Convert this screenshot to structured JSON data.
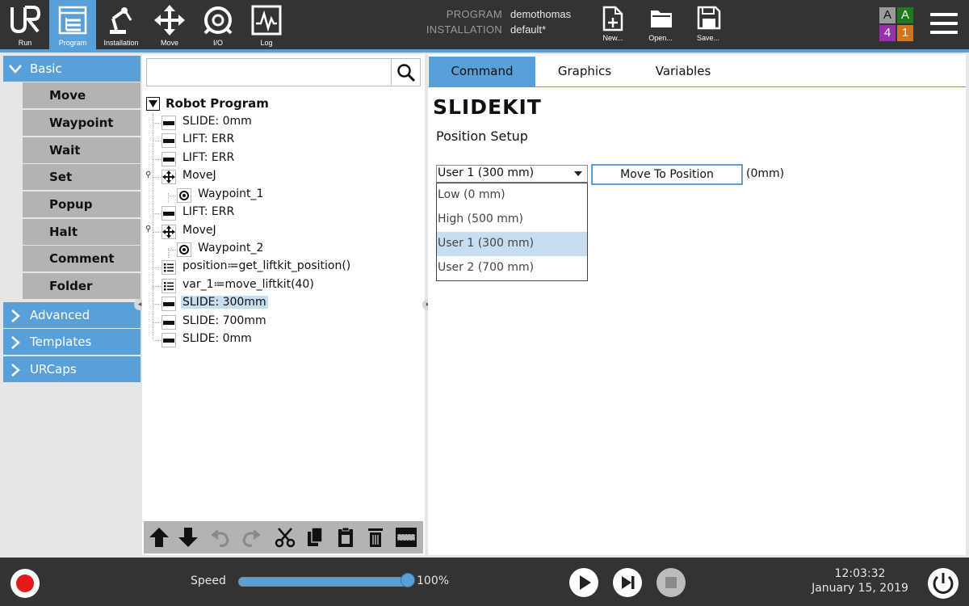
{
  "topbar": {
    "nav": [
      {
        "label": "Run",
        "icon": "ur-logo-icon",
        "active": false
      },
      {
        "label": "Program",
        "icon": "program-icon",
        "active": true
      },
      {
        "label": "Installation",
        "icon": "robot-arm-icon",
        "active": false
      },
      {
        "label": "Move",
        "icon": "move-arrows-icon",
        "active": false
      },
      {
        "label": "I/O",
        "icon": "io-icon",
        "active": false
      },
      {
        "label": "Log",
        "icon": "log-chart-icon",
        "active": false
      }
    ],
    "program_key": "PROGRAM",
    "program_value": "demothomas",
    "installation_key": "INSTALLATION",
    "installation_value": "default*",
    "file_buttons": [
      {
        "label": "New...",
        "icon": "new-file-icon"
      },
      {
        "label": "Open...",
        "icon": "open-folder-icon"
      },
      {
        "label": "Save...",
        "icon": "save-disk-icon"
      }
    ],
    "badges": [
      {
        "text": "A",
        "color": "#9a9a9a"
      },
      {
        "text": "A",
        "color": "#1f7a1f"
      },
      {
        "text": "4",
        "color": "#9b2fb2"
      },
      {
        "text": "1",
        "color": "#d6731d"
      }
    ]
  },
  "palette": {
    "basic": "Basic",
    "commands": [
      "Move",
      "Waypoint",
      "Wait",
      "Set",
      "Popup",
      "Halt",
      "Comment",
      "Folder"
    ],
    "advanced": "Advanced",
    "templates": "Templates",
    "urcaps": "URCaps"
  },
  "tree": {
    "root": "Robot Program",
    "nodes": [
      {
        "text": "SLIDE: 0mm",
        "icon": "slide-icon"
      },
      {
        "text": "LIFT: ERR",
        "icon": "slide-icon"
      },
      {
        "text": "LIFT: ERR",
        "icon": "slide-icon"
      },
      {
        "text": "MoveJ",
        "icon": "move-icon"
      },
      {
        "text": "Waypoint_1",
        "icon": "waypoint-icon"
      },
      {
        "text": "LIFT: ERR",
        "icon": "slide-icon"
      },
      {
        "text": "MoveJ",
        "icon": "move-icon"
      },
      {
        "text": "Waypoint_2",
        "icon": "waypoint-icon"
      },
      {
        "text": "position≔get_liftkit_position()",
        "icon": "assignment-icon"
      },
      {
        "text": "var_1≔move_liftkit(40)",
        "icon": "assignment-icon"
      },
      {
        "text": "SLIDE: 300mm",
        "icon": "slide-icon"
      },
      {
        "text": "SLIDE: 700mm",
        "icon": "slide-icon"
      },
      {
        "text": "SLIDE: 0mm",
        "icon": "slide-icon"
      }
    ]
  },
  "tabs": [
    "Command",
    "Graphics",
    "Variables"
  ],
  "command": {
    "title": "SLIDEKIT",
    "section": "Position Setup",
    "selected": "User 1 (300 mm)",
    "options": [
      "Low (0 mm)",
      "High (500 mm)",
      "User 1 (300 mm)",
      "User 2 (700 mm)"
    ],
    "move_button": "Move To Position",
    "readout": "(0mm)"
  },
  "bottom": {
    "speed_label": "Speed",
    "speed_value": "100%",
    "speed_fraction": 1.0,
    "time": "12:03:32",
    "date": "January 15, 2019"
  },
  "colors": {
    "accent": "#5aa0d8",
    "dark_bar": "#333333",
    "selection": "#c5def2"
  }
}
